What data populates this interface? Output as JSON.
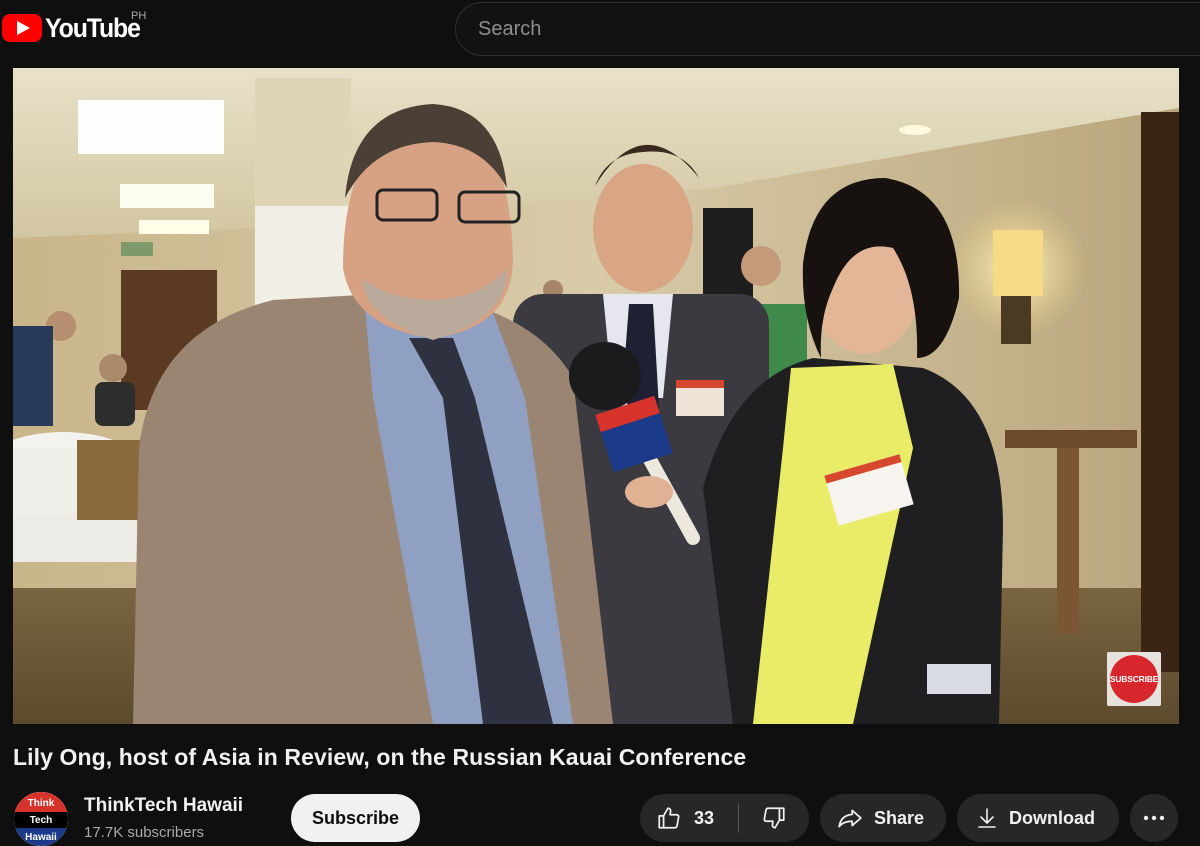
{
  "header": {
    "logo_text": "YouTube",
    "country_code": "PH",
    "search_placeholder": "Search"
  },
  "player": {
    "watermark_label": "SUBSCRIBE",
    "mic_flag_lines": [
      "Think",
      "Tech",
      "Hawaii"
    ],
    "name_tag_host": [
      "Lily",
      "Ong"
    ],
    "name_tag_guest": [
      "Roman",
      "Sirovich"
    ]
  },
  "video": {
    "title": "Lily Ong, host of Asia in Review, on the Russian Kauai Conference"
  },
  "channel": {
    "name": "ThinkTech Hawaii",
    "subscribers": "17.7K subscribers",
    "avatar_lines": [
      "Think",
      "Tech",
      "Hawaii"
    ],
    "subscribe_label": "Subscribe"
  },
  "actions": {
    "like_count": "33",
    "share_label": "Share",
    "download_label": "Download"
  },
  "icons": {
    "like": "thumbs-up-icon",
    "dislike": "thumbs-down-icon",
    "share": "share-arrow-icon",
    "download": "download-icon",
    "more": "more-horizontal-icon"
  }
}
